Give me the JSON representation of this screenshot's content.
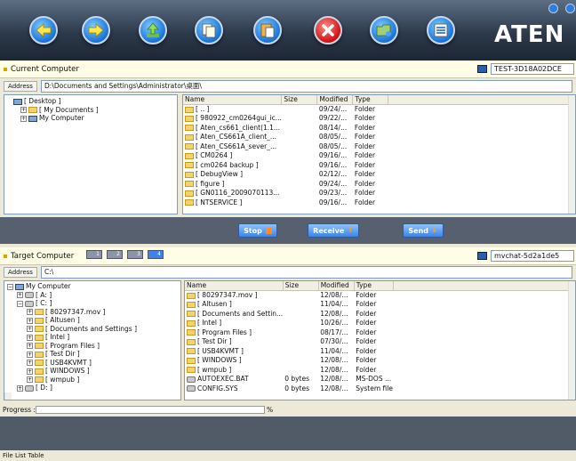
{
  "logo": "ATEN",
  "toolbar": {
    "buttons": [
      "left-arrow-icon",
      "right-arrow-icon",
      "up-icon",
      "copy-icon",
      "paste-icon",
      "delete-icon",
      "new-folder-icon",
      "list-view-icon"
    ]
  },
  "current": {
    "title": "Current Computer",
    "computer_name": "TEST-3D18A02DCE",
    "address_label": "Address",
    "address": "D:\\Documents and Settings\\Administrator\\桌面\\",
    "tree": [
      "[ Desktop ]",
      "[ My Documents ]",
      "My Computer"
    ],
    "columns": [
      "Name",
      "Size",
      "Modified",
      "Type"
    ],
    "rows": [
      [
        "[ .. ]",
        "",
        "09/24/...",
        "Folder"
      ],
      [
        "[ 980922_cm0264gui_ic...",
        "",
        "09/22/...",
        "Folder"
      ],
      [
        "[ Aten_cs661_client(1.1...",
        "",
        "08/14/...",
        "Folder"
      ],
      [
        "[ Aten_CS661A_client_...",
        "",
        "08/05/...",
        "Folder"
      ],
      [
        "[ Aten_CS661A_sever_...",
        "",
        "08/05/...",
        "Folder"
      ],
      [
        "[ CM0264 ]",
        "",
        "09/16/...",
        "Folder"
      ],
      [
        "[ cm0264 backup ]",
        "",
        "09/16/...",
        "Folder"
      ],
      [
        "[ DebugView ]",
        "",
        "02/12/...",
        "Folder"
      ],
      [
        "[ figure ]",
        "",
        "09/24/...",
        "Folder"
      ],
      [
        "[ GN0116_2009070113...",
        "",
        "09/23/...",
        "Folder"
      ],
      [
        "[ NTSERVICE ]",
        "",
        "09/16/...",
        "Folder"
      ]
    ]
  },
  "actions": {
    "stop": "Stop",
    "receive": "Receive",
    "send": "Send"
  },
  "target": {
    "title": "Target Computer",
    "pc_numbers": [
      "1",
      "2",
      "3",
      "4"
    ],
    "computer_name": "mvchat-5d2a1de5",
    "address_label": "Address",
    "address": "C:\\",
    "tree": [
      "My Computer",
      "[ A: ]",
      "[ C: ]",
      "[ 80297347.mov ]",
      "[ Altusen ]",
      "[ Documents and Settings ]",
      "[ Intel ]",
      "[ Program Files ]",
      "[ Test Dir ]",
      "[ USB4KVMT ]",
      "[ WINDOWS ]",
      "[ wmpub ]",
      "[ D: ]"
    ],
    "columns": [
      "Name",
      "Size",
      "Modified",
      "Type"
    ],
    "rows": [
      [
        "[ 80297347.mov ]",
        "",
        "12/08/...",
        "Folder"
      ],
      [
        "[ Altusen ]",
        "",
        "11/04/...",
        "Folder"
      ],
      [
        "[ Documents and Settin...",
        "",
        "12/08/...",
        "Folder"
      ],
      [
        "[ Intel ]",
        "",
        "10/26/...",
        "Folder"
      ],
      [
        "[ Program Files ]",
        "",
        "08/17/...",
        "Folder"
      ],
      [
        "[ Test Dir ]",
        "",
        "07/30/...",
        "Folder"
      ],
      [
        "[ USB4KVMT ]",
        "",
        "11/04/...",
        "Folder"
      ],
      [
        "[ WINDOWS ]",
        "",
        "12/08/...",
        "Folder"
      ],
      [
        "[ wmpub ]",
        "",
        "12/08/...",
        "Folder"
      ],
      [
        "AUTOEXEC.BAT",
        "0 bytes",
        "12/08/...",
        "MS-DOS ..."
      ],
      [
        "CONFIG.SYS",
        "0 bytes",
        "12/08/...",
        "System file"
      ]
    ]
  },
  "progress": {
    "label": "Progress :",
    "percent": "%"
  },
  "status": "File List Table"
}
